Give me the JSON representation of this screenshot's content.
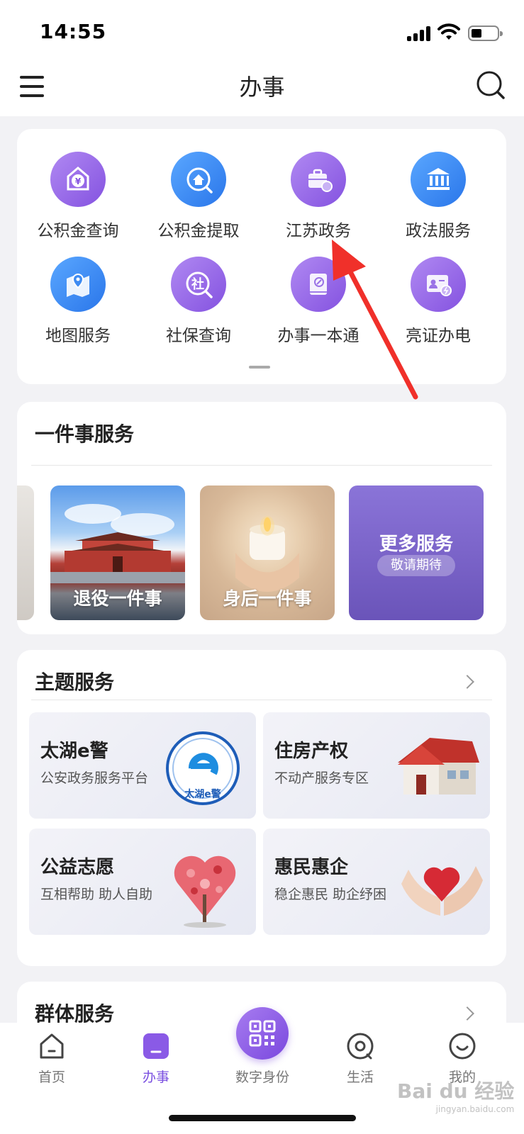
{
  "status": {
    "time": "14:55"
  },
  "header": {
    "title": "办事"
  },
  "grid": {
    "items": [
      {
        "label": "公积金查询",
        "icon": "fund-query-icon",
        "color": "purple"
      },
      {
        "label": "公积金提取",
        "icon": "fund-withdraw-icon",
        "color": "blue"
      },
      {
        "label": "江苏政务",
        "icon": "briefcase-icon",
        "color": "purple"
      },
      {
        "label": "政法服务",
        "icon": "courthouse-icon",
        "color": "blue"
      },
      {
        "label": "地图服务",
        "icon": "map-pin-icon",
        "color": "blue"
      },
      {
        "label": "社保查询",
        "icon": "social-security-icon",
        "color": "purple"
      },
      {
        "label": "办事一本通",
        "icon": "guide-book-icon",
        "color": "purple"
      },
      {
        "label": "亮证办电",
        "icon": "id-card-icon",
        "color": "purple"
      }
    ]
  },
  "one_thing": {
    "title": "一件事服务",
    "tiles": [
      {
        "label": "退役一件事"
      },
      {
        "label": "身后一件事"
      },
      {
        "label": "更多服务",
        "pill": "敬请期待"
      }
    ]
  },
  "theme": {
    "title": "主题服务",
    "tiles": [
      {
        "title": "太湖e警",
        "subtitle": "公安政务服务平台",
        "icon": "taihu-police-badge-icon"
      },
      {
        "title": "住房产权",
        "subtitle": "不动产服务专区",
        "icon": "house-icon"
      },
      {
        "title": "公益志愿",
        "subtitle": "互相帮助 助人自助",
        "icon": "heart-tree-icon"
      },
      {
        "title": "惠民惠企",
        "subtitle": "稳企惠民 助企纾困",
        "icon": "hands-heart-icon"
      }
    ],
    "badge_text": "太湖e警"
  },
  "group": {
    "title": "群体服务"
  },
  "tabbar": {
    "tabs": [
      {
        "label": "首页",
        "icon": "home-icon"
      },
      {
        "label": "办事",
        "icon": "tasks-icon",
        "active": true
      },
      {
        "label": "数字身份",
        "icon": "qr-code-icon"
      },
      {
        "label": "生活",
        "icon": "life-icon"
      },
      {
        "label": "我的",
        "icon": "profile-smile-icon"
      }
    ]
  },
  "watermark": {
    "brand": "Bai du 经验",
    "url": "jingyan.baidu.com"
  },
  "colors": {
    "accent": "#7a4fe0",
    "blue": "#2a76ea",
    "annotation_arrow": "#f0302a"
  }
}
